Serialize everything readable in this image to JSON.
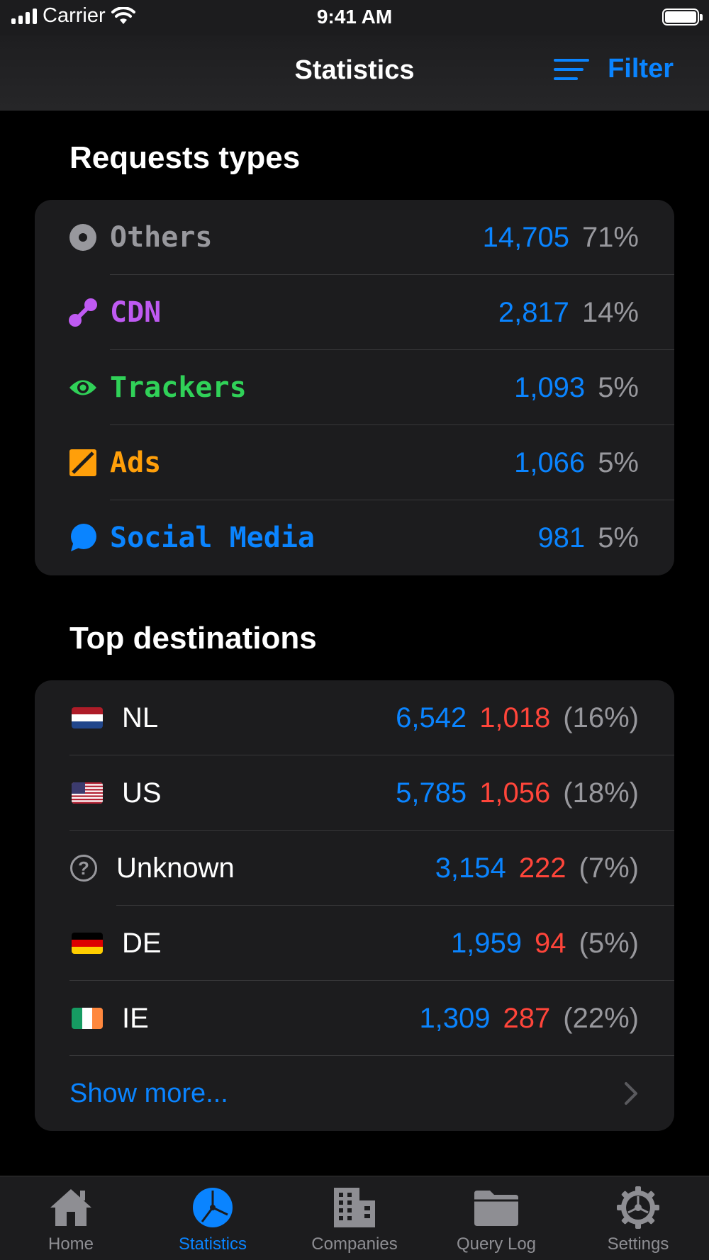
{
  "status_bar": {
    "carrier": "Carrier",
    "time": "9:41 AM"
  },
  "nav": {
    "title": "Statistics",
    "filter_label": "Filter"
  },
  "request_types": {
    "title": "Requests types",
    "items": [
      {
        "label": "Others",
        "count": "14,705",
        "percent": "71%",
        "color": "#98989d",
        "icon": "circle-dot-icon"
      },
      {
        "label": "CDN",
        "count": "2,817",
        "percent": "14%",
        "color": "#bf5af2",
        "icon": "cdn-icon"
      },
      {
        "label": "Trackers",
        "count": "1,093",
        "percent": "5%",
        "color": "#30d158",
        "icon": "eye-icon"
      },
      {
        "label": "Ads",
        "count": "1,066",
        "percent": "5%",
        "color": "#ff9f0a",
        "icon": "ads-icon"
      },
      {
        "label": "Social Media",
        "count": "981",
        "percent": "5%",
        "color": "#0a84ff",
        "icon": "chat-bubble-icon"
      }
    ]
  },
  "top_destinations": {
    "title": "Top destinations",
    "items": [
      {
        "country": "NL",
        "total": "6,542",
        "blocked": "1,018",
        "percent": "(16%)",
        "icon": "flag-nl-icon"
      },
      {
        "country": "US",
        "total": "5,785",
        "blocked": "1,056",
        "percent": "(18%)",
        "icon": "flag-us-icon"
      },
      {
        "country": "Unknown",
        "total": "3,154",
        "blocked": "222",
        "percent": "(7%)",
        "icon": "question-circle-icon"
      },
      {
        "country": "DE",
        "total": "1,959",
        "blocked": "94",
        "percent": "(5%)",
        "icon": "flag-de-icon"
      },
      {
        "country": "IE",
        "total": "1,309",
        "blocked": "287",
        "percent": "(22%)",
        "icon": "flag-ie-icon"
      }
    ],
    "show_more": "Show more..."
  },
  "tabs": [
    {
      "label": "Home",
      "icon": "house-icon",
      "active": false
    },
    {
      "label": "Statistics",
      "icon": "pie-chart-icon",
      "active": true
    },
    {
      "label": "Companies",
      "icon": "building-icon",
      "active": false
    },
    {
      "label": "Query Log",
      "icon": "folder-icon",
      "active": false
    },
    {
      "label": "Settings",
      "icon": "gear-icon",
      "active": false
    }
  ]
}
